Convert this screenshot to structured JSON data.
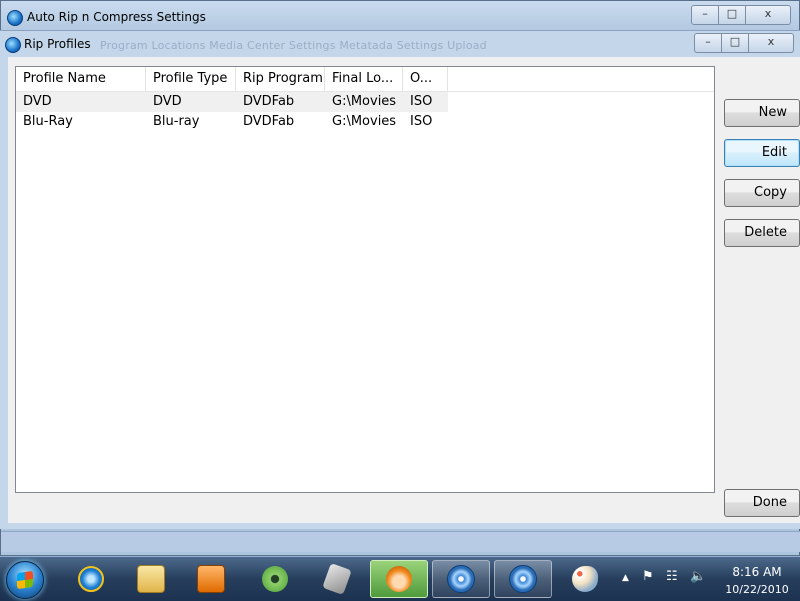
{
  "outer_window": {
    "title": "Auto Rip n Compress Settings",
    "minimize_glyph": "–",
    "maximize_glyph": "□",
    "close_glyph": "x"
  },
  "inner_window": {
    "title": "Rip Profiles",
    "background_tabs_text": "Program Locations    Media Center Settings    Metatada Settings    Upload",
    "minimize_glyph": "–",
    "maximize_glyph": "□",
    "close_glyph": "x"
  },
  "profiles_list": {
    "columns": [
      "Profile Name",
      "Profile Type",
      "Rip Program",
      "Final Lo...",
      "O..."
    ],
    "rows": [
      [
        "DVD",
        "DVD",
        "DVDFab",
        "G:\\Movies",
        "ISO"
      ],
      [
        "Blu-Ray",
        "Blu-ray",
        "DVDFab",
        "G:\\Movies",
        "ISO"
      ]
    ]
  },
  "buttons": {
    "new": "New",
    "edit": "Edit",
    "copy": "Copy",
    "delete": "Delete",
    "done": "Done"
  },
  "taskbar": {
    "items": [
      "start-orb",
      "internet-explorer-icon",
      "folder-icon",
      "media-player-icon",
      "gear-app-icon",
      "tool-icon",
      "cartoon-face-icon",
      "disc-icon",
      "disc-icon",
      "paint-palette-icon"
    ],
    "tray": {
      "arrow_glyph": "▲",
      "flag_glyph": "⚑",
      "network_glyph": "☷",
      "volume_glyph": "🔈",
      "time": "8:16 AM",
      "date": "10/22/2010"
    }
  },
  "colors": {
    "focus_button_border": "#3c7fb1",
    "active_task_green": "#4f9a3c"
  }
}
